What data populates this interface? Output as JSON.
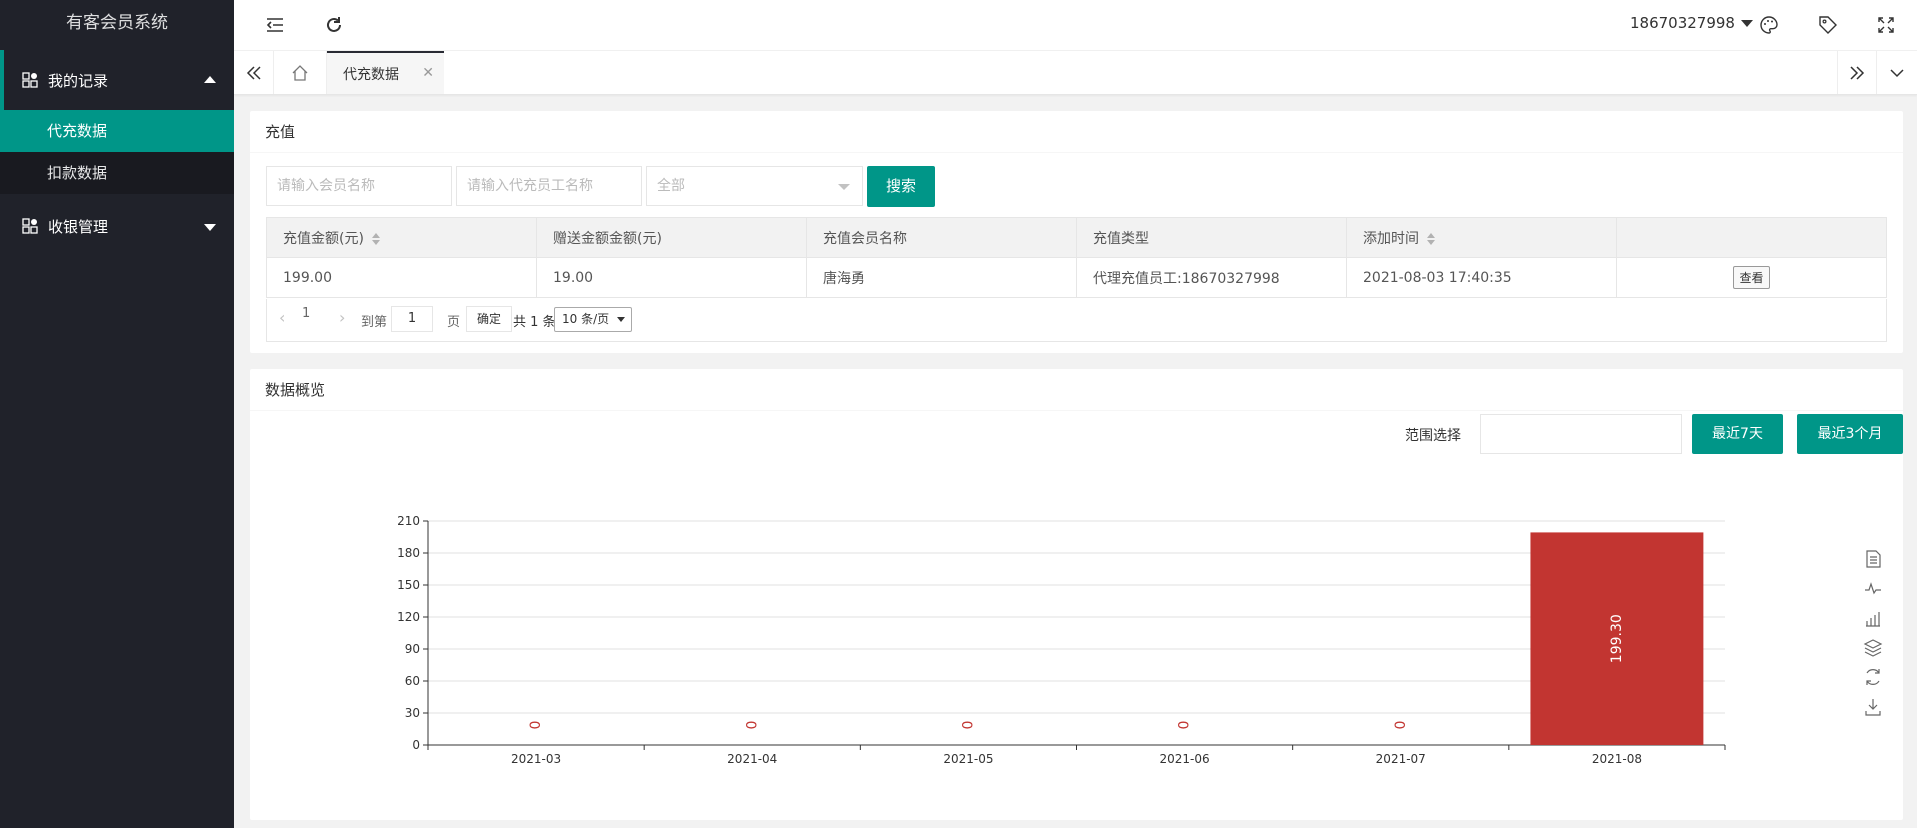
{
  "app": {
    "title": "有客会员系统"
  },
  "sidebar": {
    "groups": [
      {
        "label": "我的记录",
        "items": [
          {
            "label": "代充数据"
          },
          {
            "label": "扣款数据"
          }
        ]
      },
      {
        "label": "收银管理"
      }
    ]
  },
  "header": {
    "user": "18670327998"
  },
  "tabs": {
    "active": "代充数据"
  },
  "recharge": {
    "title": "充值",
    "search": {
      "member_placeholder": "请输入会员名称",
      "staff_placeholder": "请输入代充员工名称",
      "type_value": "全部",
      "button": "搜索"
    },
    "table": {
      "headers": [
        "充值金额(元)",
        "赠送金额金额(元)",
        "充值会员名称",
        "充值类型",
        "添加时间",
        ""
      ],
      "rows": [
        [
          "199.00",
          "19.00",
          "唐海勇",
          "代理充值员工:18670327998",
          "2021-08-03 17:40:35",
          "查看"
        ]
      ]
    },
    "pager": {
      "current": "1",
      "goto_label": "到第",
      "goto_value": "1",
      "page_unit": "页",
      "confirm": "确定",
      "total": "共 1 条",
      "page_size": "10 条/页"
    }
  },
  "overview": {
    "title": "数据概览",
    "range_label": "范围选择",
    "btn_7days": "最近7天",
    "btn_3months": "最近3个月"
  },
  "chart_data": {
    "type": "bar",
    "categories": [
      "2021-03",
      "2021-04",
      "2021-05",
      "2021-06",
      "2021-07",
      "2021-08"
    ],
    "values": [
      0,
      0,
      0,
      0,
      0,
      199.3
    ],
    "value_labels": [
      "0",
      "0",
      "0",
      "0",
      "0",
      "199.30"
    ],
    "ylim": [
      0,
      210
    ],
    "yticks": [
      0,
      30,
      60,
      90,
      120,
      150,
      180,
      210
    ],
    "grid": true,
    "bar_color": "#c23531",
    "toolbox": [
      "data-view-icon",
      "line-chart-icon",
      "bar-chart-icon",
      "stack-icon",
      "restore-icon",
      "save-image-icon"
    ]
  },
  "colors": {
    "accent": "#009688",
    "sidebar_bg": "#20222a",
    "bar": "#c23531"
  }
}
